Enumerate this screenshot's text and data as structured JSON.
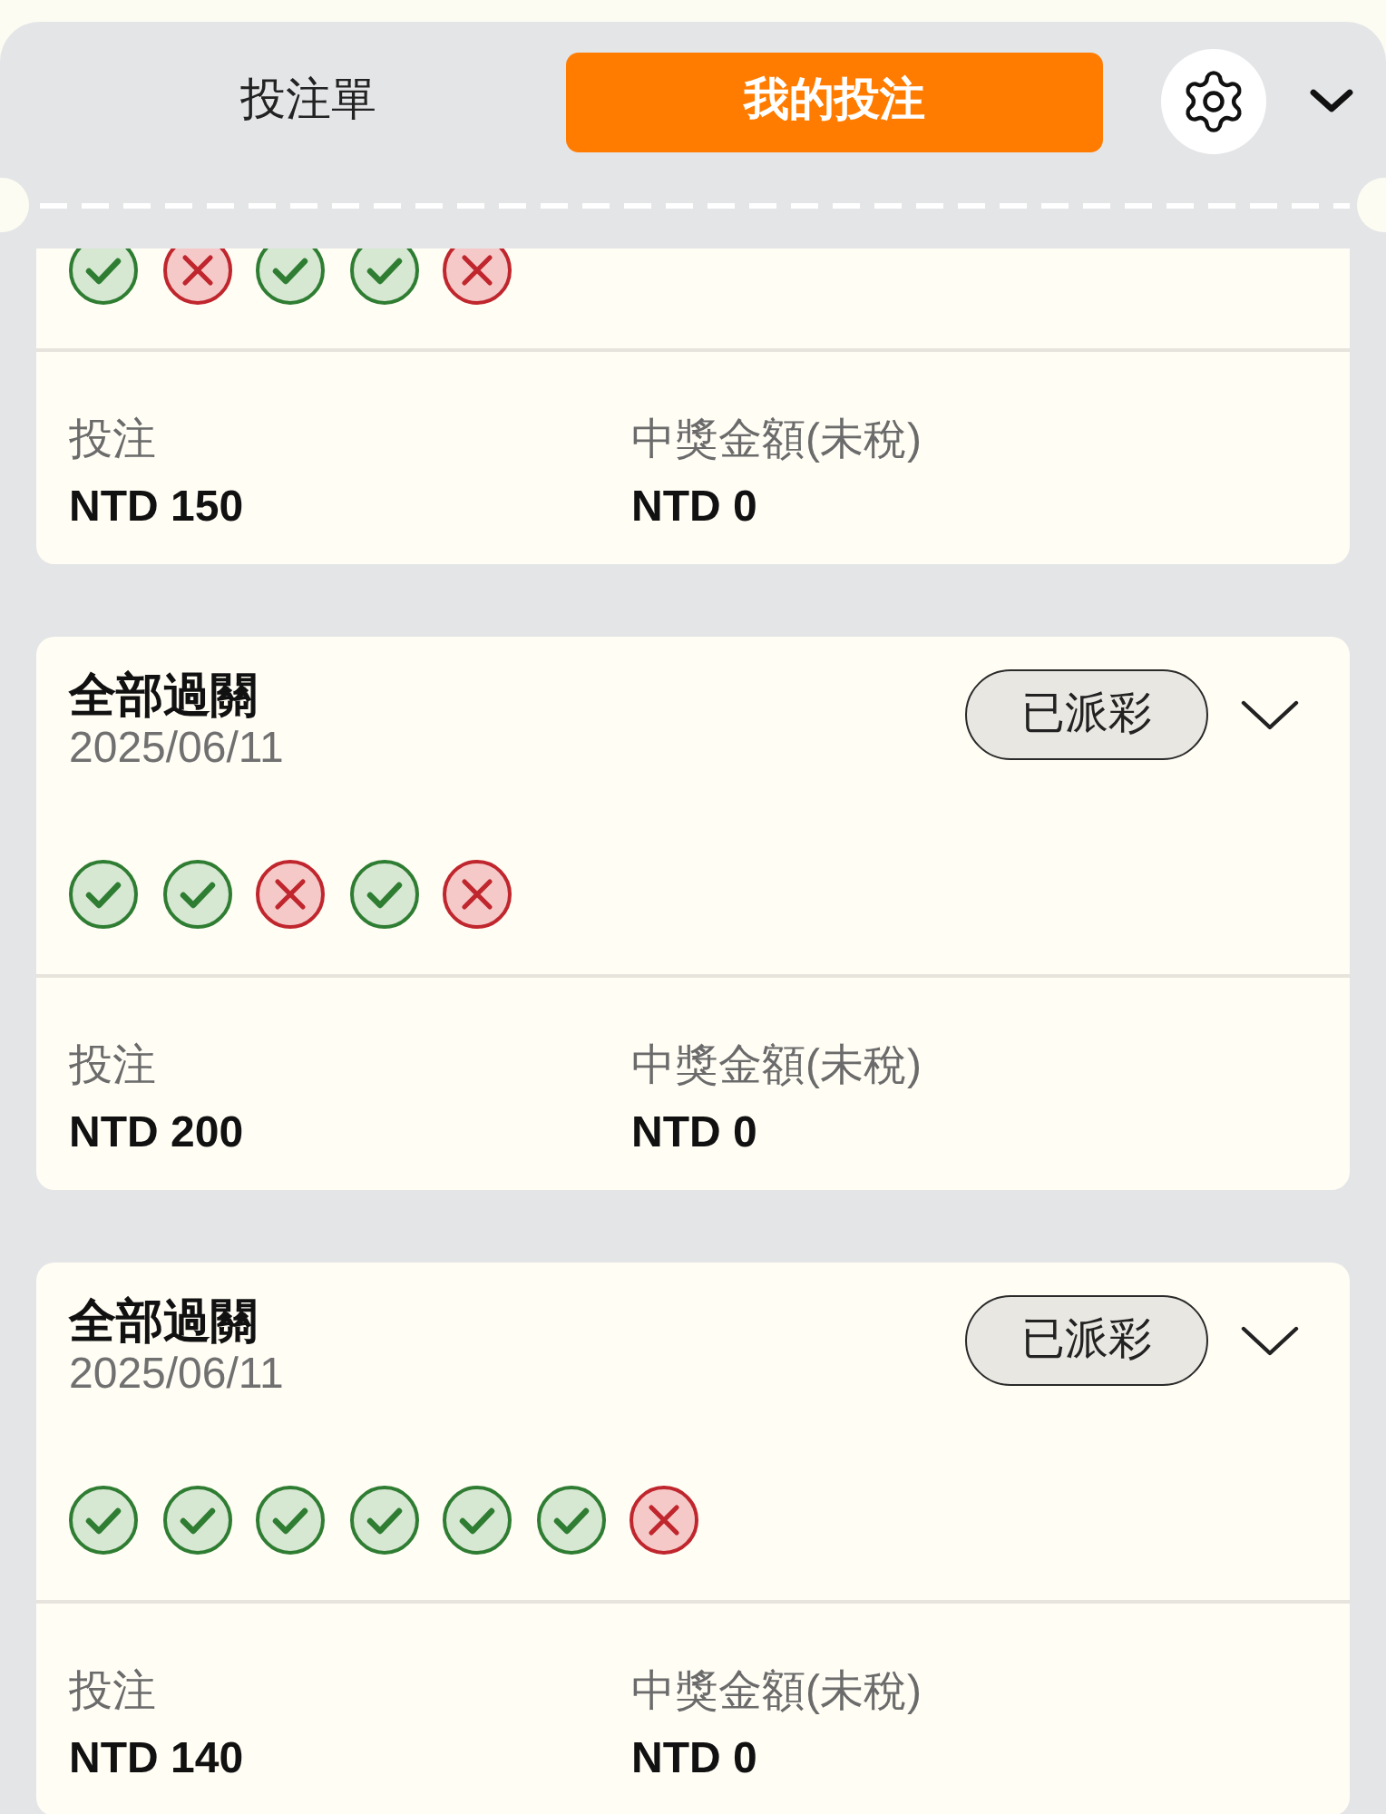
{
  "tabs": [
    {
      "label": "投注單",
      "selected": false
    },
    {
      "label": "我的投注",
      "selected": true
    }
  ],
  "bets": [
    {
      "legs": [
        {
          "kind": "win"
        },
        {
          "kind": "loss"
        },
        {
          "kind": "win"
        },
        {
          "kind": "win"
        },
        {
          "kind": "loss"
        }
      ],
      "stake_label": "投注",
      "stake": "NTD 150",
      "payout_label": "中獎金額(未稅)",
      "payout": "NTD 0"
    },
    {
      "title": "全部過關",
      "date": "2025/06/11",
      "status": "已派彩",
      "legs": [
        {
          "kind": "win"
        },
        {
          "kind": "win"
        },
        {
          "kind": "loss"
        },
        {
          "kind": "win"
        },
        {
          "kind": "loss"
        }
      ],
      "stake_label": "投注",
      "stake": "NTD 200",
      "payout_label": "中獎金額(未稅)",
      "payout": "NTD 0"
    },
    {
      "title": "全部過關",
      "date": "2025/06/11",
      "status": "已派彩",
      "legs": [
        {
          "kind": "win"
        },
        {
          "kind": "win"
        },
        {
          "kind": "win"
        },
        {
          "kind": "win"
        },
        {
          "kind": "win"
        },
        {
          "kind": "win"
        },
        {
          "kind": "loss"
        }
      ],
      "stake_label": "投注",
      "stake": "NTD 140",
      "payout_label": "中獎金額(未稅)",
      "payout": "NTD 0"
    }
  ]
}
